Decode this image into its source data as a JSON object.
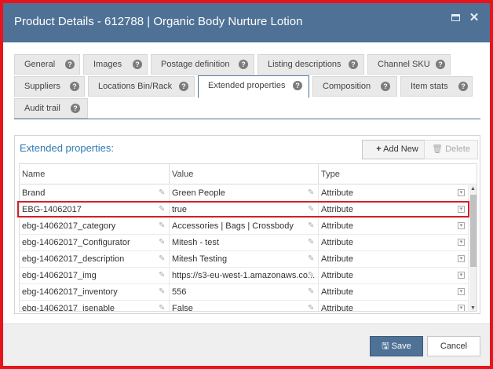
{
  "window": {
    "title": "Product Details - 612788 | Organic Body Nurture Lotion",
    "maximize_icon": "maximize-icon",
    "close_icon": "close-icon",
    "close_glyph": "✕"
  },
  "tabs": [
    {
      "label": "General"
    },
    {
      "label": "Images"
    },
    {
      "label": "Postage definition"
    },
    {
      "label": "Listing descriptions"
    },
    {
      "label": "Channel SKU"
    },
    {
      "label": "Suppliers"
    },
    {
      "label": "Locations Bin/Rack"
    },
    {
      "label": "Extended properties",
      "active": true
    },
    {
      "label": "Composition"
    },
    {
      "label": "Item stats"
    },
    {
      "label": "Audit trail"
    }
  ],
  "panel": {
    "title": "Extended properties:",
    "add_label": "Add New",
    "delete_label": "Delete"
  },
  "grid": {
    "columns": [
      "Name",
      "Value",
      "Type"
    ],
    "rows": [
      {
        "name": "Brand",
        "value": "Green People",
        "type": "Attribute"
      },
      {
        "name": "EBG-14062017",
        "value": "true",
        "type": "Attribute"
      },
      {
        "name": "ebg-14062017_category",
        "value": "Accessories | Bags | Crossbody",
        "type": "Attribute"
      },
      {
        "name": "ebg-14062017_Configurator",
        "value": "Mitesh - test",
        "type": "Attribute"
      },
      {
        "name": "ebg-14062017_description",
        "value": "Mitesh Testing",
        "type": "Attribute"
      },
      {
        "name": "ebg-14062017_img",
        "value": "https://s3-eu-west-1.amazonaws.co...",
        "type": "Attribute"
      },
      {
        "name": "ebg-14062017_inventory",
        "value": "556",
        "type": "Attribute"
      },
      {
        "name": "ebg-14062017_isenable",
        "value": "False",
        "type": "Attribute"
      }
    ],
    "highlighted_row": "EBG-14062017"
  },
  "footer": {
    "save_label": "Save",
    "cancel_label": "Cancel"
  },
  "colors": {
    "titlebar": "#4f7196",
    "frame_border": "#e8141c",
    "accent_text": "#2e7bb5",
    "highlight": "#d3202a"
  }
}
